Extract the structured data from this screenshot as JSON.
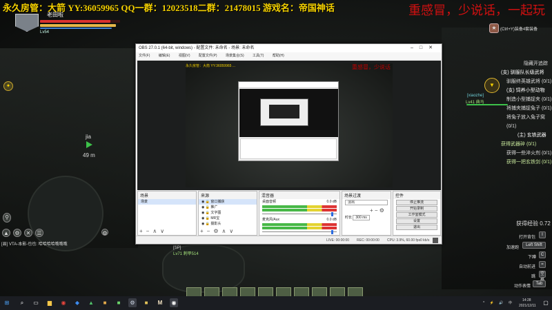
{
  "game": {
    "banner_left": "永久房管：大箭 YY:36059965 QQ一群：12023518二群：21478015 游戏名：帝国神话",
    "banner_right": "重感冒，少说话，一起玩",
    "player": {
      "name": "老田啦",
      "level": "Lv54",
      "hp_fraction": 0.88
    },
    "shortcut_hint": "(Ctrl+Y)装备4套装备",
    "marker": {
      "name": "jia",
      "distance": "49 m"
    },
    "chat_line": "[县] VTA-本影-也也: 哈哈哈哈哦哦哦",
    "npc1": {
      "name": "[xiaozhe]",
      "level": "Lv41 典马"
    },
    "npc2": {
      "name": "[SP]",
      "level": "Lv71 刺甲514"
    },
    "quest_panel": {
      "title": "隐藏开追踪",
      "items": [
        "(支) 驯服队长级武将",
        "驯服终英雄武将 (0/1)",
        "(支) 饲养小型动物",
        "制造小型捕捉夹 (0/1)",
        "将捕夹捕捉兔子 (0/1)",
        "将兔子放入兔子窝 (0/1)",
        "(主) 玄铁武器",
        "获得武器碎 (0/1)",
        "获得一些淬火剂 (0/1)",
        "获得一把玄铁剑 (0/1)"
      ]
    },
    "exp_text": "获得经验 0.72",
    "keybinds": [
      {
        "label": "打开背包",
        "key": "I"
      },
      {
        "label": "加速跑",
        "key": "Left Shift"
      },
      {
        "label": "下蹲",
        "key": "C"
      },
      {
        "label": "自动前进",
        "key": "="
      },
      {
        "label": "跳",
        "key": "空格"
      },
      {
        "label": "动作表情",
        "key": "Tab"
      }
    ]
  },
  "obs": {
    "title": "OBS 27.0.1 (64-bit, windows) - 配置文件: 未命名 - 场景: 未命名",
    "menu": [
      "文件(F)",
      "编辑(E)",
      "视图(V)",
      "配置文件(P)",
      "场景集合(S)",
      "工具(T)",
      "帮助(H)"
    ],
    "panels": {
      "scenes": {
        "title": "场景",
        "items": [
          "场景"
        ]
      },
      "sources": {
        "title": "来源",
        "items": [
          "窗口捕获",
          "推广",
          "文字图",
          "MR宝",
          "摄影头"
        ]
      },
      "mixer": {
        "title": "混音器",
        "tracks": [
          {
            "name": "桌面音频",
            "level_db": "0.0 dB",
            "volume": 0.95
          },
          {
            "name": "麦克风/Aux",
            "level_db": "0.0 dB",
            "volume": 0.95
          }
        ]
      },
      "transitions": {
        "title": "场景过渡",
        "type": "淡出",
        "duration_label": "时长",
        "duration": "300 ms"
      },
      "controls": {
        "title": "控件",
        "buttons": [
          "停止推流",
          "开始录制",
          "工作室模式",
          "设置",
          "退出"
        ]
      }
    },
    "status": {
      "live": "LIVE: 00:00:00",
      "rec": "REC: 00:00:00",
      "cpu": "CPU: 3.9%, 60.00 fps",
      "kbps": "0 kb/s"
    }
  },
  "taskbar": {
    "time": "14:28",
    "date": "2021/12/11"
  }
}
